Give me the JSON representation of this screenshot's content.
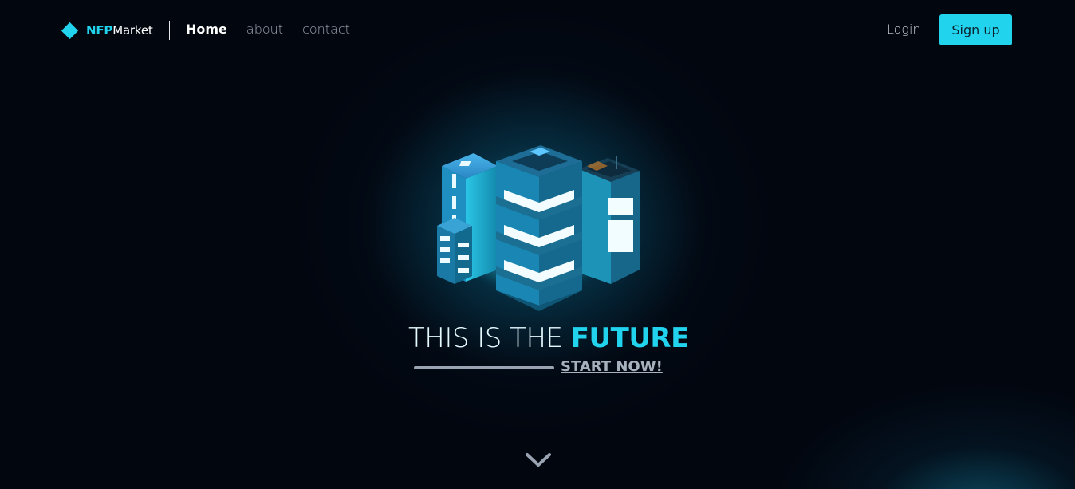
{
  "brand": {
    "name_accent": "NFP",
    "name_rest": "Market",
    "logo_icon": "diamond-icon",
    "accent_color": "#22d3ee"
  },
  "nav": {
    "links": [
      {
        "label": "Home",
        "active": true
      },
      {
        "label": "about",
        "active": false
      },
      {
        "label": "contact",
        "active": false
      }
    ],
    "login_label": "Login",
    "signup_label": "Sign up"
  },
  "hero": {
    "illustration": "isometric-glowing-buildings-illustration",
    "headline_lead": "THIS IS THE ",
    "headline_accent": "FUTURE",
    "cta_label": "START NOW!",
    "scroll_icon": "chevron-down-icon"
  },
  "colors": {
    "background": "#02060f",
    "glow": "#1496b4",
    "accent": "#22d3ee"
  }
}
